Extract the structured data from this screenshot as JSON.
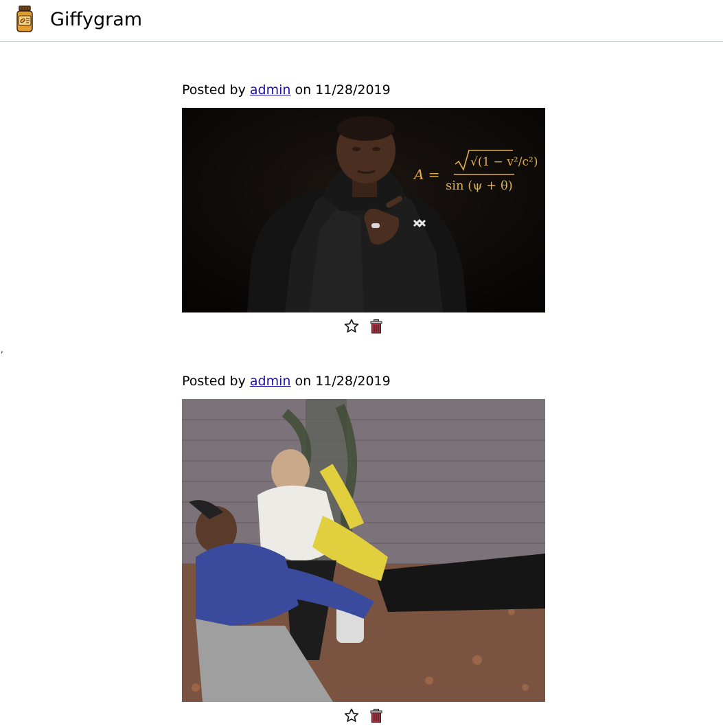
{
  "app": {
    "title": "Giffygram",
    "logo_icon": "pill-bottle-icon"
  },
  "stray_text": ",",
  "posts": [
    {
      "prefix": "Posted by",
      "author": "admin",
      "on_word": "on",
      "date": "11/28/2019",
      "image_alt": "Man in black hoodie doing calculations, equation overlay",
      "equation_lhs": "A =",
      "equation_numerator": "√(1 − v²/c²)",
      "equation_denominator": "sin (ψ + θ)",
      "actions": [
        "star-icon",
        "trash-icon"
      ]
    },
    {
      "prefix": "Posted by",
      "author": "admin",
      "on_word": "on",
      "date": "11/28/2019",
      "image_alt": "Three people pulling a person in autumn leaves",
      "actions": [
        "star-icon",
        "trash-icon"
      ]
    }
  ],
  "colors": {
    "link": "#1a0dab",
    "divider": "#c8d4d8",
    "equation": "#e0b04a",
    "trash": "#b03040"
  }
}
